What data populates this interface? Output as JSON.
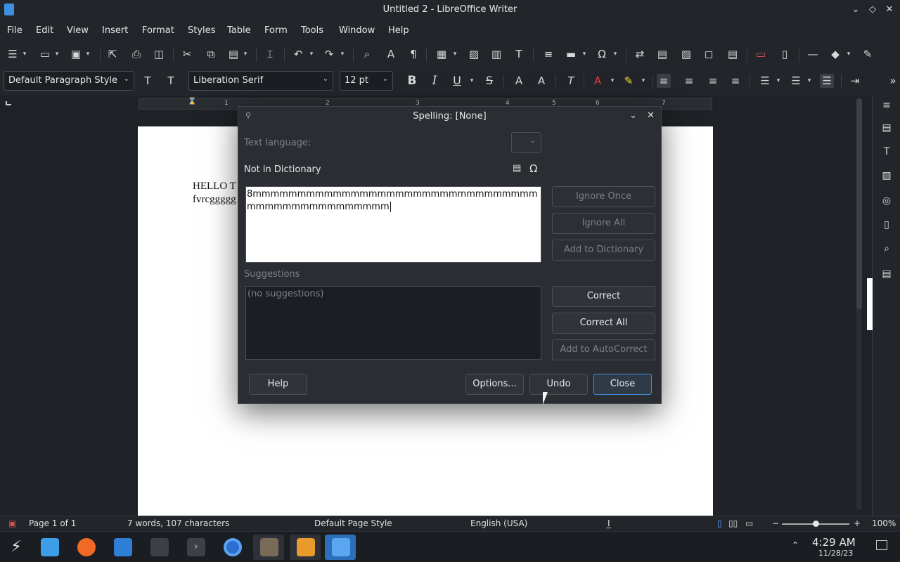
{
  "window": {
    "title": "Untitled 2 - LibreOffice Writer"
  },
  "menu": [
    "File",
    "Edit",
    "View",
    "Insert",
    "Format",
    "Styles",
    "Table",
    "Form",
    "Tools",
    "Window",
    "Help"
  ],
  "formatting": {
    "paragraph_style": "Default Paragraph Style",
    "font_name": "Liberation Serif",
    "font_size": "12 pt"
  },
  "ruler": {
    "marks": [
      "1",
      "2",
      "3",
      "4",
      "5",
      "6",
      "7"
    ]
  },
  "document": {
    "line1": "HELLO T",
    "line2": "fvrcggggg"
  },
  "dialog": {
    "title": "Spelling: [None]",
    "text_language_label": "Text language:",
    "not_in_dictionary_label": "Not in Dictionary",
    "not_in_dictionary_text": "8mmmmmmmmmmmmmmmmmmmmmmmmmmmmmmmmmmmmmmmmmmmmmmmm",
    "suggestions_label": "Suggestions",
    "suggestions_empty": "(no suggestions)",
    "buttons": {
      "ignore_once": "Ignore Once",
      "ignore_all": "Ignore All",
      "add_to_dictionary": "Add to Dictionary",
      "correct": "Correct",
      "correct_all": "Correct All",
      "add_to_autocorrect": "Add to AutoCorrect",
      "help": "Help",
      "options": "Options...",
      "undo": "Undo",
      "close": "Close"
    }
  },
  "status": {
    "page": "Page 1 of 1",
    "words": "7 words, 107 characters",
    "page_style": "Default Page Style",
    "language": "English (USA)",
    "zoom": "100%"
  },
  "taskbar": {
    "time": "4:29 AM",
    "date": "11/28/23"
  }
}
